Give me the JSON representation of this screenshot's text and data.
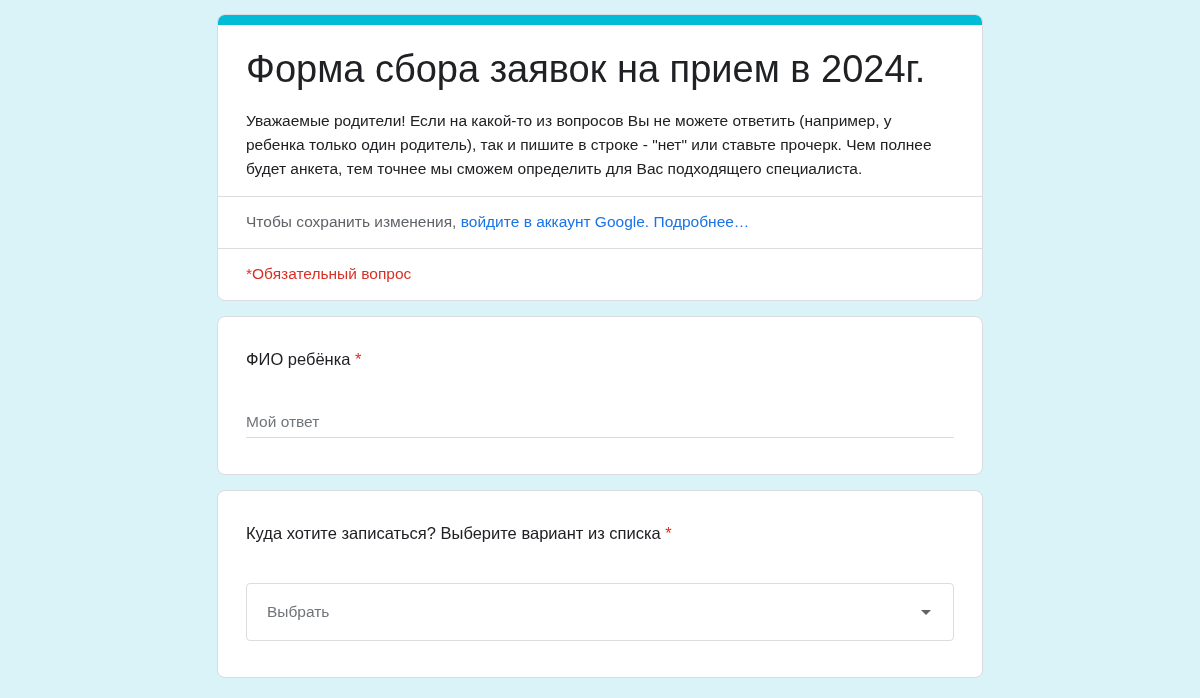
{
  "header": {
    "title": "Форма сбора заявок на прием в 2024г.",
    "description": "Уважаемые родители! Если на какой-то из вопросов Вы не можете ответить (например, у ребенка только один родитель), так и пишите в строке - \"нет\" или ставьте прочерк. Чем полнее будет анкета, тем точнее мы сможем определить для Вас подходящего специалиста.",
    "save_notice": {
      "text": "Чтобы сохранить изменения,",
      "links": [
        "войдите в аккаунт Google.",
        "Подробнее…"
      ]
    },
    "required_note": "*Обязательный вопрос"
  },
  "questions": [
    {
      "kind": "text",
      "label": "ФИО ребёнка",
      "mark": "*",
      "placeholder": "Мой ответ"
    },
    {
      "kind": "dropdown",
      "label": "Куда хотите записаться? Выберите вариант из списка",
      "mark": "*",
      "placeholder": "Выбрать"
    }
  ]
}
